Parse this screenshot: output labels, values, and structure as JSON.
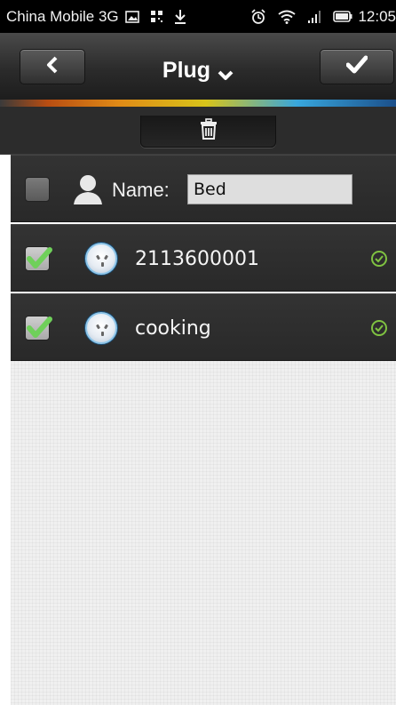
{
  "status_bar": {
    "carrier": "China Mobile 3G",
    "time": "12:05",
    "icons": [
      "image-icon",
      "qr-icon",
      "download-icon",
      "alarm-icon",
      "wifi-icon",
      "signal-icon",
      "battery-icon"
    ]
  },
  "header": {
    "title": "Plug",
    "back_icon": "chevron-left-icon",
    "title_dropdown_icon": "chevron-down-icon",
    "confirm_icon": "checkmark-icon"
  },
  "toolbar": {
    "delete_icon": "trash-icon"
  },
  "form": {
    "name_label": "Name:",
    "name_value": "Bed",
    "name_checked": false
  },
  "devices": [
    {
      "label": "2113600001",
      "checked": true,
      "status_icon": "ok-circle-icon"
    },
    {
      "label": "cooking",
      "checked": true,
      "status_icon": "ok-circle-icon"
    }
  ],
  "colors": {
    "accent_green": "#7cd26a",
    "status_green": "#7fc241",
    "header_bg": "#2b2b2b"
  }
}
